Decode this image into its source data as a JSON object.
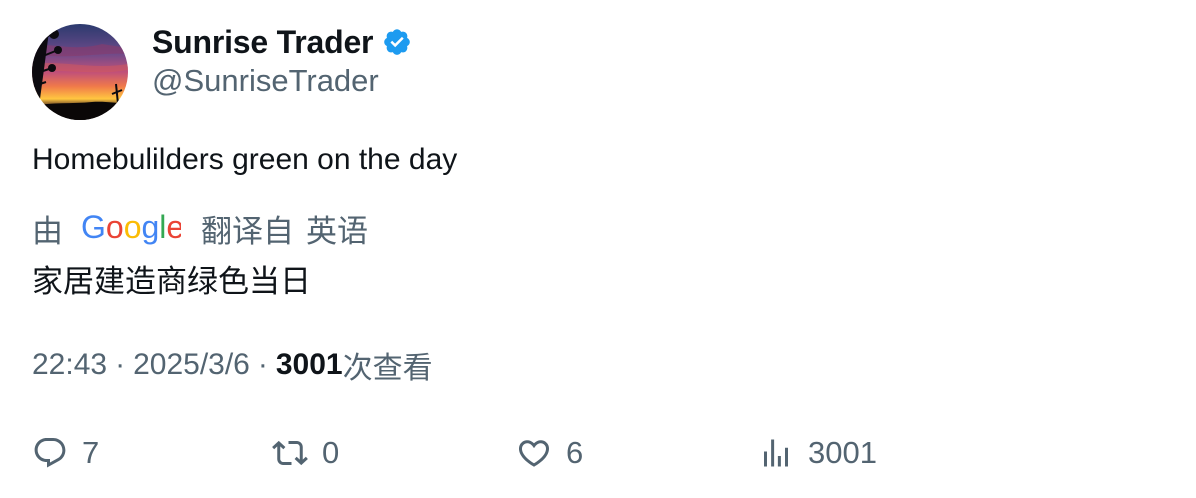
{
  "user": {
    "display_name": "Sunrise Trader",
    "handle": "@SunriseTrader",
    "verified_icon": "verified-badge-icon",
    "avatar": "sunset-landscape"
  },
  "tweet": {
    "text": "Homebulilders green on the day"
  },
  "translation": {
    "by": "由",
    "provider": "Google",
    "translated_from": "翻译自",
    "language": "英语",
    "text": "家居建造商绿色当日"
  },
  "meta": {
    "time": "22:43",
    "separator": "·",
    "date": "2025/3/6",
    "views_count": "3001",
    "views_label": "次查看"
  },
  "actions": {
    "reply_count": "7",
    "retweet_count": "0",
    "like_count": "6",
    "views_count": "3001"
  },
  "colors": {
    "text_primary": "#0f1419",
    "text_secondary": "#536471",
    "verified": "#1d9bf0"
  }
}
